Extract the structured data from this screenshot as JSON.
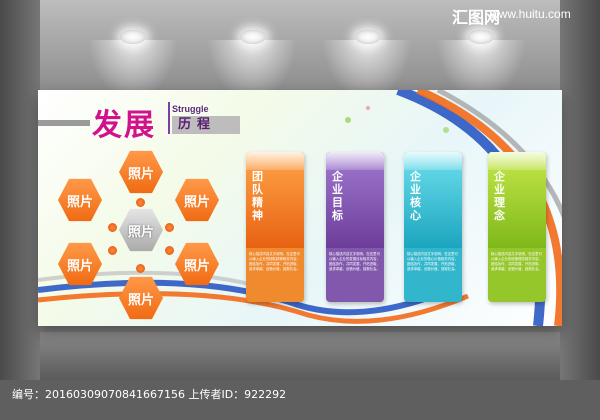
{
  "watermark": {
    "brand": "汇图网",
    "url": "www.huitu.com",
    "footer": "编号：20160309070841667156 上传者ID：922292"
  },
  "board": {
    "title_main": "发展",
    "title_sub_en": "Struggle",
    "title_sub_cn": "历程",
    "photos": [
      "照片",
      "照片",
      "照片",
      "照片",
      "照片",
      "照片",
      "照片"
    ],
    "cards": [
      {
        "title": "团队精神",
        "color": "#f08a2e",
        "body": "核心描述内容文字说明，在这里可以输入企业的团队精神相关内容，团结协作，共同发展，开拓进取，追求卓越，创造价值，回报社会。"
      },
      {
        "title": "企业目标",
        "color": "#8258ad",
        "body": "核心描述内容文字说明，在这里可以输入企业的发展目标相关内容，团结协作，共同发展，开拓进取，追求卓越，创造价值，回报社会。"
      },
      {
        "title": "企业核心",
        "color": "#32b6cc",
        "body": "核心描述内容文字说明，在这里可以输入企业的核心价值相关内容，团结协作，共同发展，开拓进取，追求卓越，创造价值，回报社会。"
      },
      {
        "title": "企业理念",
        "color": "#95c62a",
        "body": "核心描述内容文字说明，在这里可以输入企业的经营理念相关内容，团结协作，共同发展，开拓进取，追求卓越，创造价值，回报社会。"
      }
    ]
  }
}
